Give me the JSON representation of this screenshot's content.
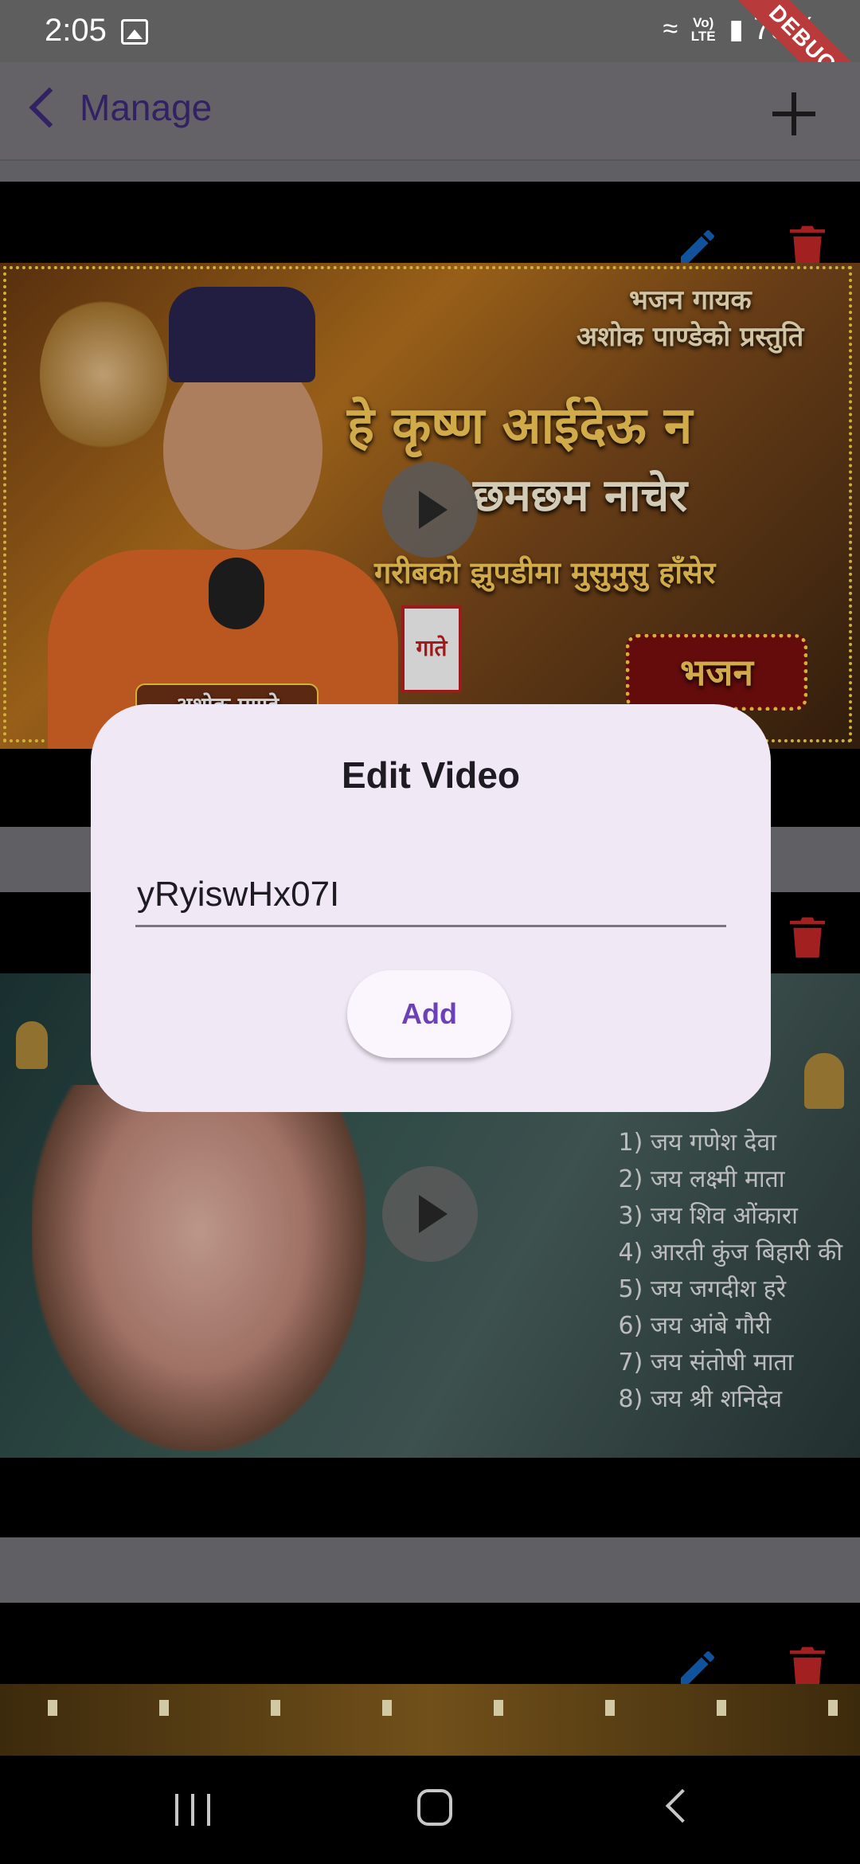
{
  "status_bar": {
    "time": "2:05",
    "lte_label": "Vo) LTE",
    "battery": "78%",
    "debug_label": "DEBUG"
  },
  "app_bar": {
    "back_label": "Manage"
  },
  "videos": [
    {
      "line1": "भजन गायक",
      "line2": "अशोक पाण्डेको प्रस्तुति",
      "title_a": "हे कृष्ण आईदेऊ न",
      "title_b": "छमछम नाचेर",
      "title_c": "गरीबको झुपडीमा मुसुमुसु हाँसेर",
      "badge": "भजन",
      "name_tag": "अशोक पाण्डे",
      "mic_tag": "गाते"
    },
    {
      "items": [
        "1) जय गणेश देवा",
        "2) जय लक्ष्मी माता",
        "3) जय शिव ओंकारा",
        "4) आरती कुंज बिहारी की",
        "5) जय जगदीश हरे",
        "6) जय आंबे गौरी",
        "7) जय संतोषी माता",
        "8) जय श्री शनिदेव"
      ]
    },
    {}
  ],
  "dialog": {
    "title": "Edit Video",
    "video_id": "yRyiswHx07I",
    "add_label": "Add"
  },
  "icons": {
    "edit": "pencil-icon",
    "delete": "trash-icon",
    "play": "play-icon",
    "add": "plus-icon",
    "back": "chevron-left-icon"
  },
  "colors": {
    "accent": "#6c41b7",
    "edit_icon": "#1565c0",
    "delete_icon": "#c62828",
    "dialog_bg": "#f1e8f6"
  }
}
